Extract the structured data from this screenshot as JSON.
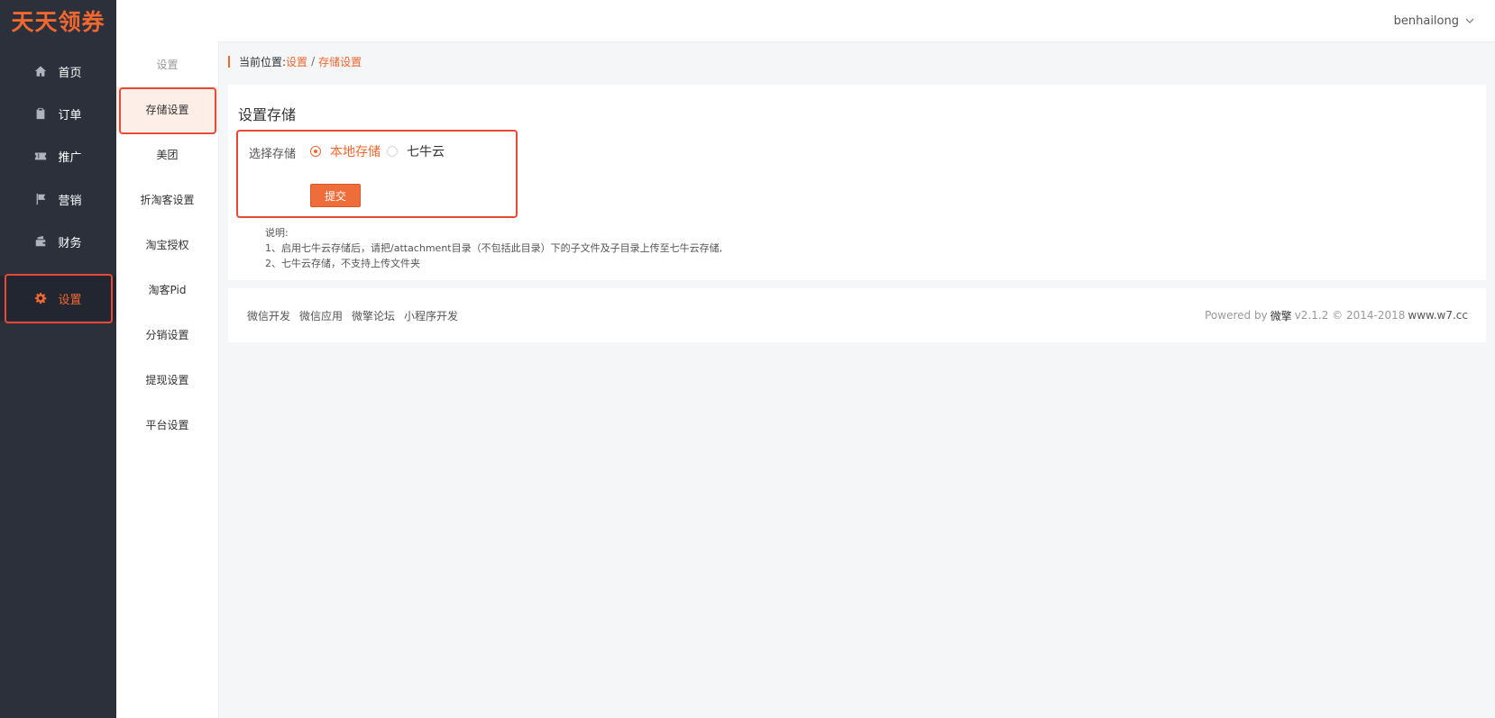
{
  "brand": {
    "title": "天天领券"
  },
  "header": {
    "username": "benhailong"
  },
  "sidebar": {
    "items": [
      {
        "label": "首页",
        "icon": "home-icon"
      },
      {
        "label": "订单",
        "icon": "clipboard-icon"
      },
      {
        "label": "推广",
        "icon": "ticket-icon"
      },
      {
        "label": "营销",
        "icon": "flag-icon"
      },
      {
        "label": "财务",
        "icon": "wallet-icon"
      },
      {
        "label": "设置",
        "icon": "gear-icon",
        "active": true
      }
    ]
  },
  "subnav": {
    "title": "设置",
    "items": [
      {
        "label": "存储设置",
        "active": true
      },
      {
        "label": "美团"
      },
      {
        "label": "折淘客设置"
      },
      {
        "label": "淘宝授权"
      },
      {
        "label": "淘客Pid"
      },
      {
        "label": "分销设置"
      },
      {
        "label": "提现设置"
      },
      {
        "label": "平台设置"
      }
    ]
  },
  "breadcrumb": {
    "prefix": "当前位置:",
    "items": [
      "设置",
      "存储设置"
    ],
    "separator": "/"
  },
  "panel": {
    "title": "设置存储",
    "storage_label": "选择存储",
    "options": [
      {
        "label": "本地存储",
        "checked": true
      },
      {
        "label": "七牛云",
        "checked": false
      }
    ],
    "submit_label": "提交",
    "notes": [
      "说明:",
      "1、启用七牛云存储后，请把/attachment目录（不包括此目录）下的子文件及子目录上传至七牛云存储,",
      "2、七牛云存储，不支持上传文件夹"
    ]
  },
  "footer": {
    "links": [
      "微信开发",
      "微信应用",
      "微擎论坛",
      "小程序开发"
    ],
    "powered_prefix": "Powered by",
    "powered_brand": "微擎",
    "powered_version": "v2.1.2 © 2014-2018",
    "powered_site": "www.w7.cc"
  },
  "colors": {
    "accent": "#f0672f",
    "sidebar_bg": "#2b303b",
    "highlight_border": "#e84a36"
  }
}
